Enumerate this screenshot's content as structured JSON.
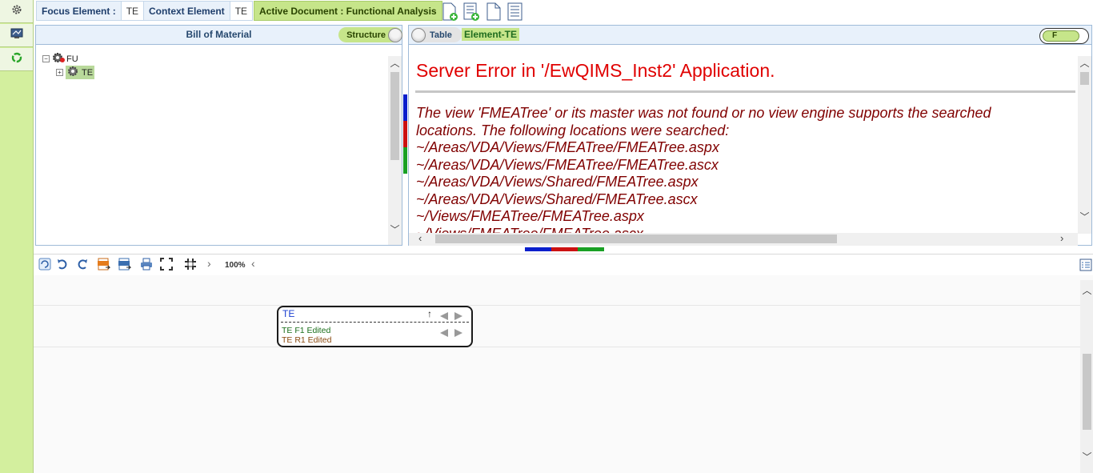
{
  "topbar": {
    "focus_label": "Focus Element :",
    "focus_value": "TE",
    "context_label": "Context Element",
    "context_value": "TE",
    "active_doc": "Active Document : Functional Analysis"
  },
  "left_panel": {
    "title": "Bill of Material",
    "toggle_label": "Structure",
    "tree": [
      {
        "label": "FU",
        "expanded": true
      },
      {
        "label": "TE",
        "expanded": false,
        "selected": true
      }
    ]
  },
  "right_panel": {
    "toggle_label": "Table",
    "element_label": "Element-TE",
    "f_toggle": "F",
    "error_title": "Server Error in '/EwQIMS_Inst2' Application.",
    "error_lines": [
      "The view 'FMEATree' or its master was not found or no view engine supports the searched",
      "locations. The following locations were searched:",
      "~/Areas/VDA/Views/FMEATree/FMEATree.aspx",
      "~/Areas/VDA/Views/FMEATree/FMEATree.ascx",
      "~/Areas/VDA/Views/Shared/FMEATree.aspx",
      "~/Areas/VDA/Views/Shared/FMEATree.ascx",
      "~/Views/FMEATree/FMEATree.aspx",
      "~/Views/FMEATree/FMEATree.ascx"
    ]
  },
  "bottom": {
    "zoom": "100%",
    "node": {
      "title": "TE",
      "function": "TE F1 Edited",
      "requirement": "TE R1 Edited"
    }
  },
  "colors": {
    "rail": "#d3ef9e",
    "accent_green": "#c6e58a",
    "error_red": "#e00000",
    "error_maroon": "#800000",
    "strip_blue": "#0a1fcc",
    "strip_red": "#cc1111",
    "strip_green": "#19a024"
  }
}
